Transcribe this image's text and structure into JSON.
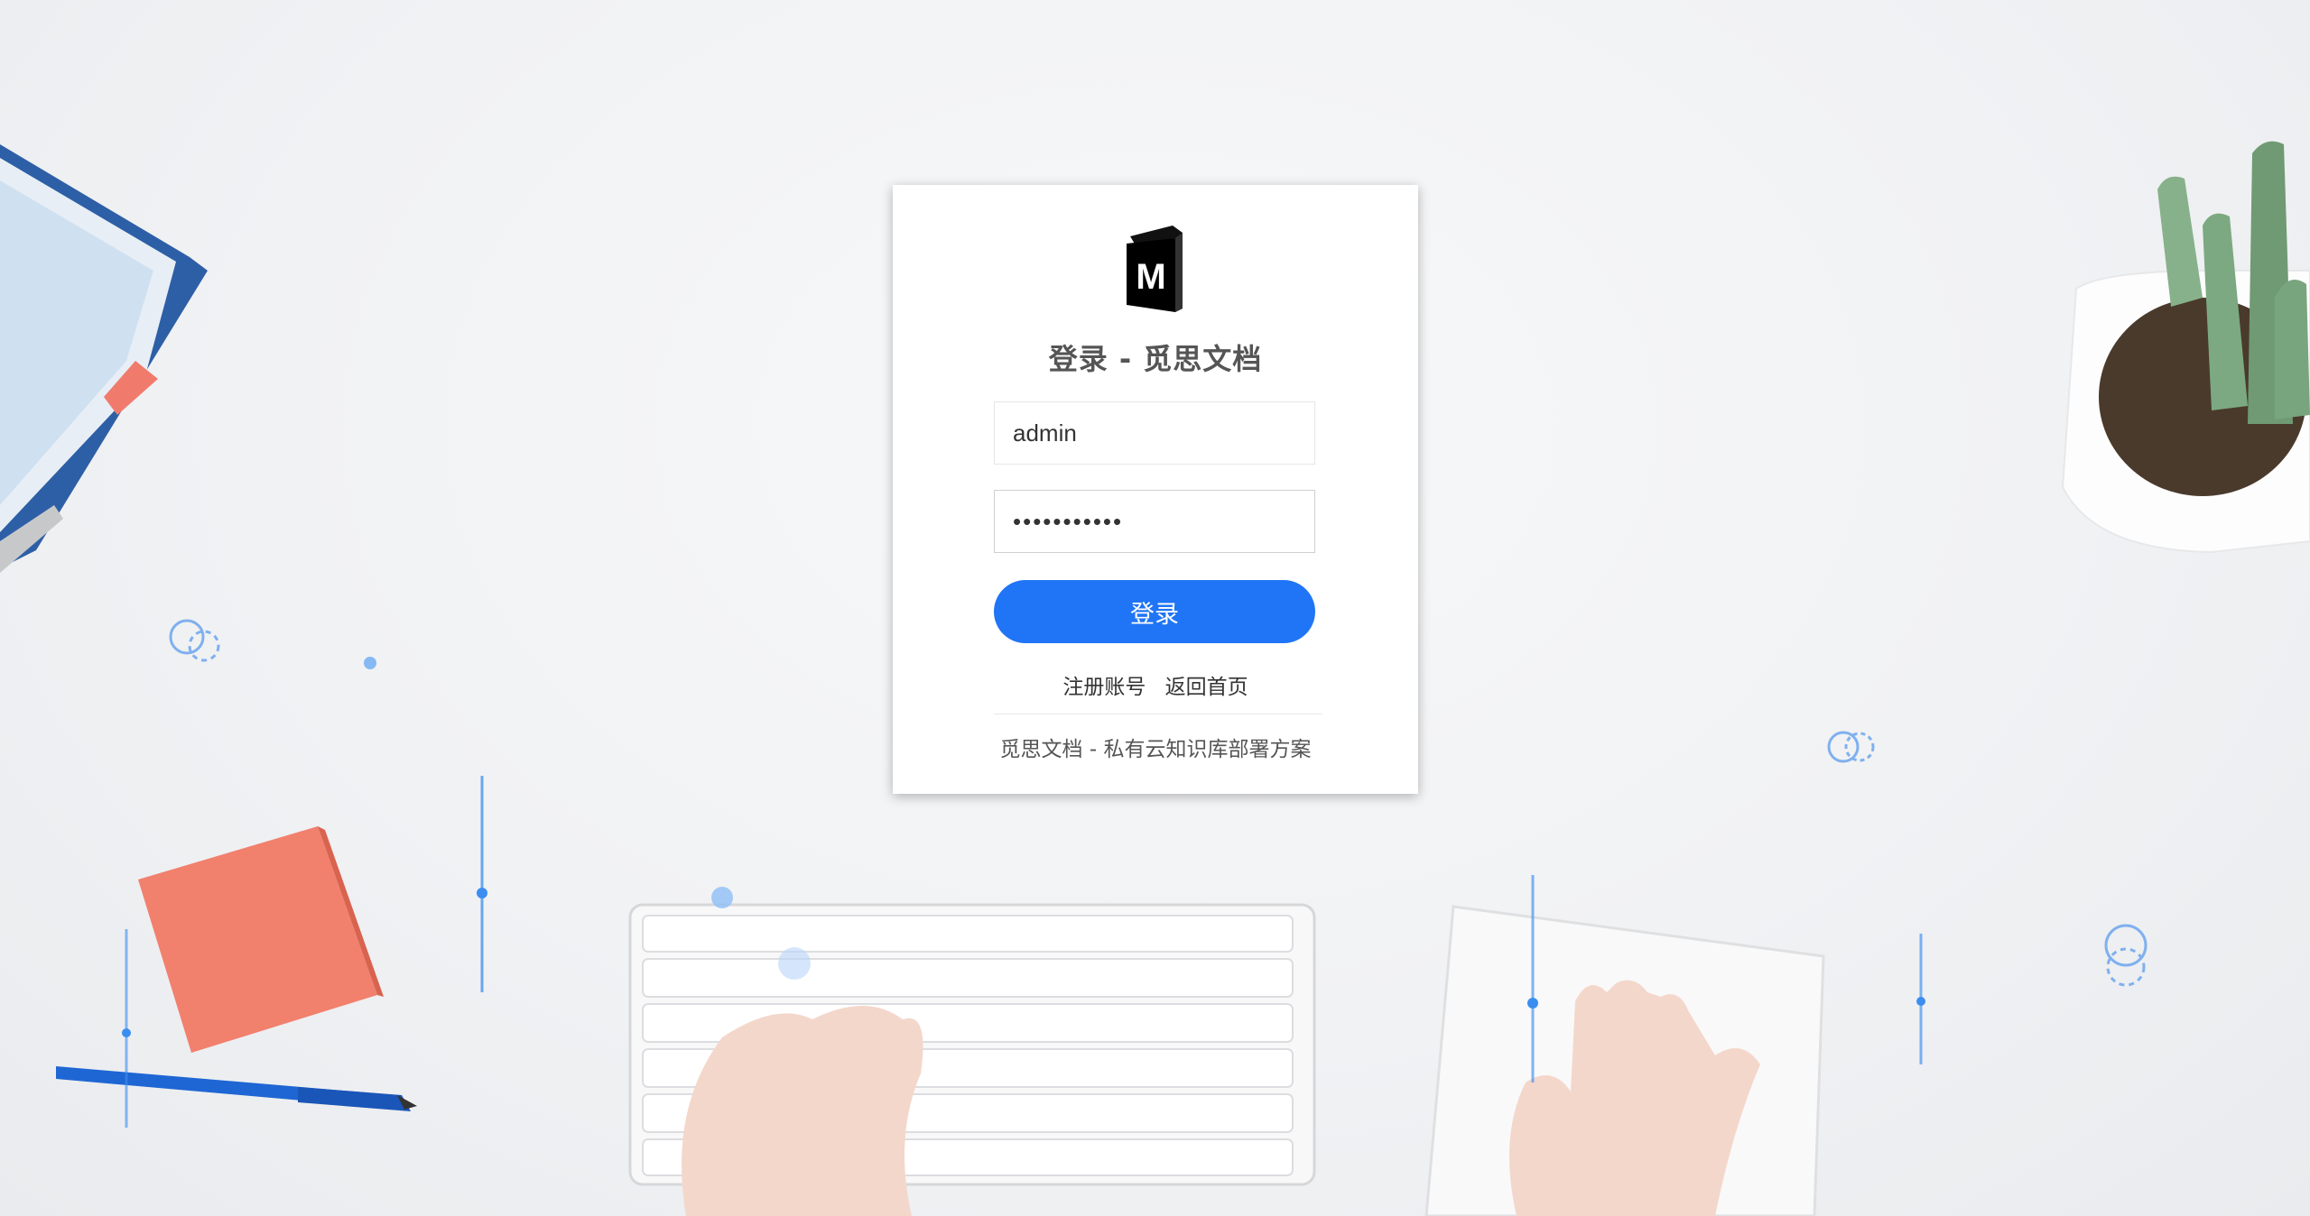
{
  "login": {
    "title": "登录 - 觅思文档",
    "username_value": "admin",
    "password_value": "•••••••••••",
    "submit_label": "登录",
    "register_link": "注册账号",
    "home_link": "返回首页",
    "footer": "觅思文档 - 私有云知识库部署方案",
    "logo_letter": "M"
  },
  "colors": {
    "accent": "#1f75f5",
    "card": "#ffffff",
    "title": "#555555"
  },
  "icons": [
    "book-logo-icon"
  ]
}
